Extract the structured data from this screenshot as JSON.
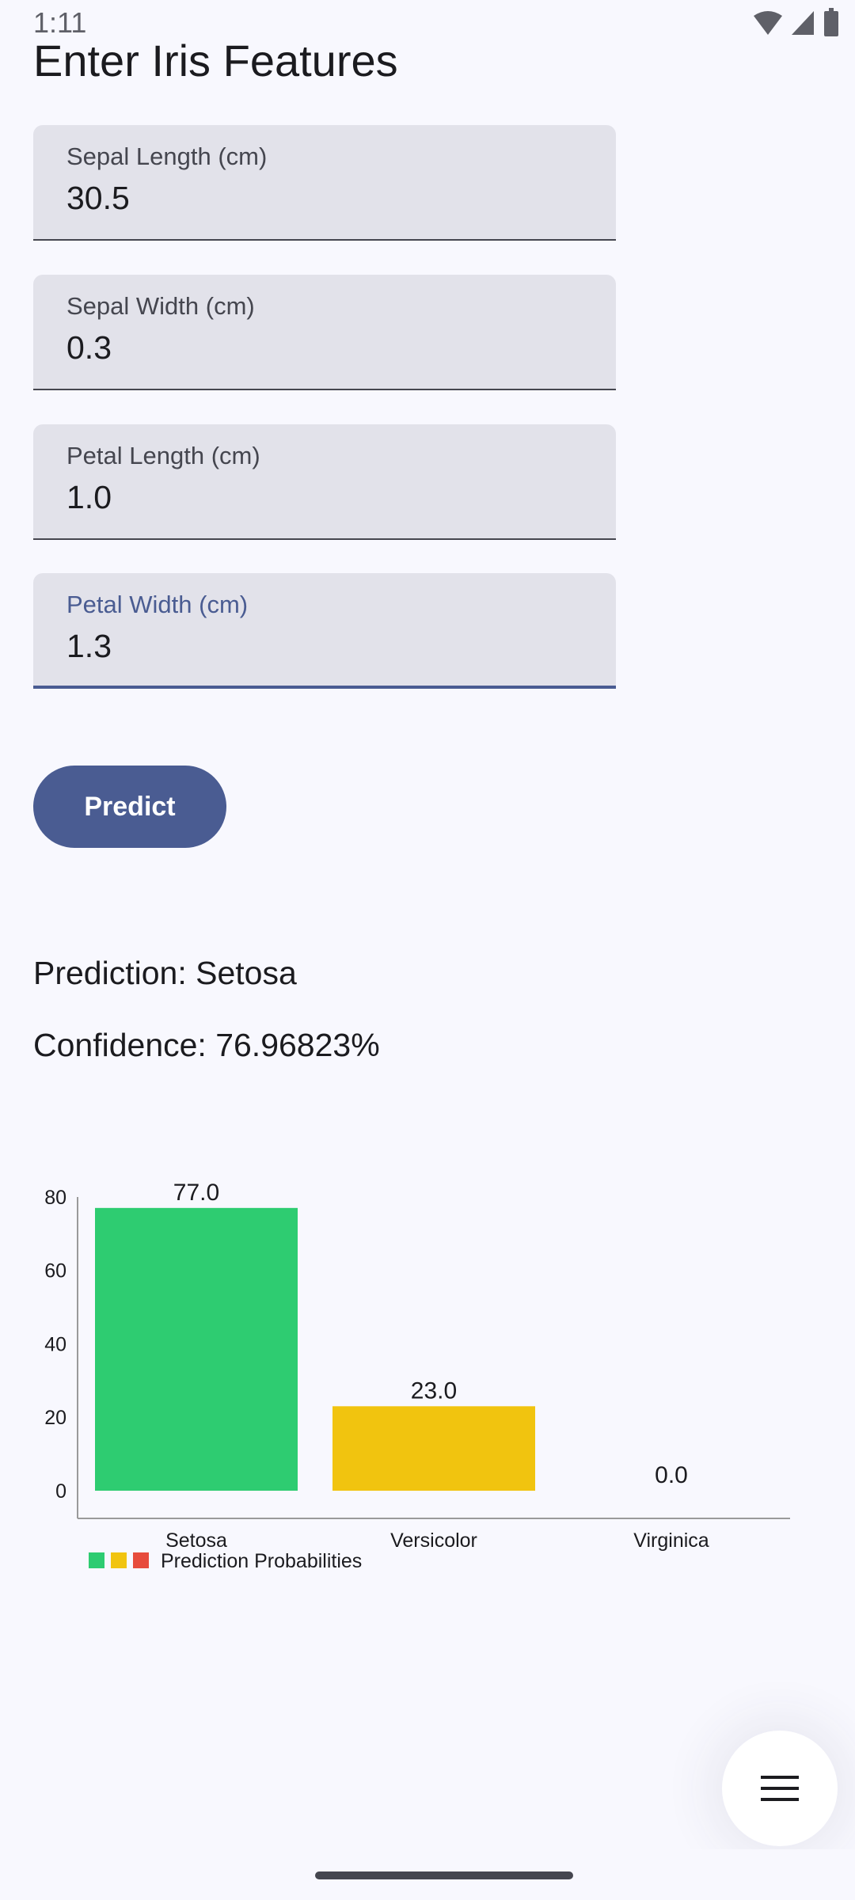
{
  "status_bar": {
    "time": "1:11",
    "icons": [
      "wifi-icon",
      "signal-icon",
      "battery-icon"
    ]
  },
  "page": {
    "title": "Enter Iris Features"
  },
  "form": {
    "fields": [
      {
        "label": "Sepal Length (cm)",
        "value": "30.5",
        "focused": false
      },
      {
        "label": "Sepal Width (cm)",
        "value": "0.3",
        "focused": false
      },
      {
        "label": "Petal Length (cm)",
        "value": "1.0",
        "focused": false
      },
      {
        "label": "Petal Width (cm)",
        "value": "1.3",
        "focused": true
      }
    ],
    "predict_label": "Predict"
  },
  "result": {
    "prediction": "Prediction: Setosa",
    "confidence": "Confidence: 76.96823%"
  },
  "colors": {
    "primary": "#4a5c92",
    "field_bg": "#e2e2ea",
    "background": "#f8f8fe"
  },
  "fab": {
    "icon": "menu-icon"
  },
  "chart_data": {
    "type": "bar",
    "categories": [
      "Setosa",
      "Versicolor",
      "Virginica"
    ],
    "values": [
      77.0,
      23.0,
      0.0
    ],
    "value_labels": [
      "77.0",
      "23.0",
      "0.0"
    ],
    "colors": [
      "#2ecc71",
      "#f1c40f",
      "#e74c3c"
    ],
    "legend_label": "Prediction Probabilities",
    "yticks": [
      0,
      20,
      40,
      60,
      80
    ],
    "ylim": [
      0,
      83
    ],
    "grid": false,
    "legend_position": "bottom-left"
  }
}
